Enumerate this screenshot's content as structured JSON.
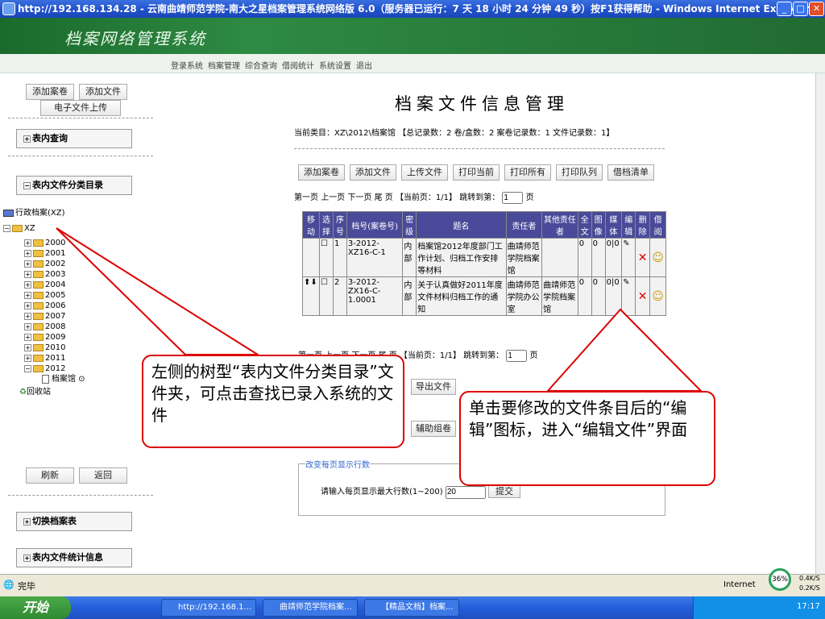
{
  "window": {
    "title": "http://192.168.134.28 - 云南曲靖师范学院-南大之星档案管理系统网络版 6.0（服务器已运行：7 天 18 小时 24 分钟 49 秒）按F1获得帮助 - Windows Internet Explorer"
  },
  "banner": {
    "title": "档案网络管理系统"
  },
  "topnav": [
    "登录系统",
    "档案管理",
    "综合查询",
    "借阅统计",
    "系统设置",
    "退出"
  ],
  "left": {
    "buttons": {
      "add_volume": "添加案卷",
      "add_file": "添加文件",
      "upload": "电子文件上传",
      "refresh": "刷新",
      "back": "返回"
    },
    "sections": {
      "query": "表内查询",
      "classify": "表内文件分类目录",
      "switch": "切换档案表",
      "stats": "表内文件统计信息"
    },
    "tree": {
      "root": "行政档案(XZ)",
      "node": "XZ",
      "years": [
        "2000",
        "2001",
        "2002",
        "2003",
        "2004",
        "2005",
        "2006",
        "2007",
        "2008",
        "2009",
        "2010",
        "2011",
        "2012"
      ],
      "leaf": "档案馆",
      "recycle": "回收站"
    }
  },
  "main": {
    "title": "档案文件信息管理",
    "summary": "当前类目：XZ\\2012\\档案馆 【总记录数：2 卷/盒数：2 案卷记录数：1 文件记录数：1】",
    "toolbar": [
      "添加案卷",
      "添加文件",
      "上传文件",
      "打印当前",
      "打印所有",
      "打印队列",
      "借档清单"
    ],
    "pager": {
      "first": "第一页",
      "prev": "上一页",
      "next": "下一页",
      "last": "尾 页",
      "current": "【当前页：1/1】",
      "jump": "跳转到第：",
      "jump_value": "1",
      "page": "页"
    },
    "pager2": {
      "text": "第一页 上一页 下一页 尾 页 【当前页：1/1】 跳转到第：",
      "jump_value": "1",
      "page": "页"
    },
    "headers": [
      "移动",
      "选择",
      "序号",
      "档号(案卷号)",
      "密级",
      "题名",
      "责任者",
      "其他责任者",
      "全文",
      "图像",
      "媒体",
      "编辑",
      "删除",
      "借阅"
    ],
    "rows": [
      {
        "seq": "1",
        "code": "3-2012-XZ16-C-1",
        "secret": "内部",
        "title": "档案馆2012年度部门工作计划、归档工作安排等材料",
        "resp": "曲靖师范学院档案馆",
        "other": "",
        "fulltext": "0",
        "image": "0",
        "media": "0|0"
      },
      {
        "seq": "2",
        "code": "3-2012-ZX16-C-1.0001",
        "secret": "内部",
        "title": "关于认真做好2011年度文件材料归档工作的通知",
        "resp": "曲靖师范学院办公室",
        "other": "曲靖师范学院档案馆",
        "fulltext": "0",
        "image": "0",
        "media": "0|0"
      }
    ],
    "bottom_buttons": [
      "导出文件",
      "辅助组卷"
    ],
    "rows_legend": "改变每页显示行数",
    "rows_prompt": "请输入每页显示最大行数(1~200)",
    "rows_value": "20",
    "submit": "提交"
  },
  "callouts": {
    "left": "左侧的树型“表内文件分类目录”文件夹，可点击查找已录入系统的文件",
    "right": "单击要修改的文件条目后的“编辑”图标，进入“编辑文件”界面"
  },
  "status": {
    "done": "完毕",
    "zone": "Internet",
    "percent": "36%",
    "up": "0.4K/S",
    "down": "0.2K/S"
  },
  "taskbar": {
    "start": "开始",
    "tasks": [
      "http://192.168.1...",
      "曲靖师范学院档案...",
      "【精品文档】档案..."
    ],
    "clock": "17:17"
  }
}
